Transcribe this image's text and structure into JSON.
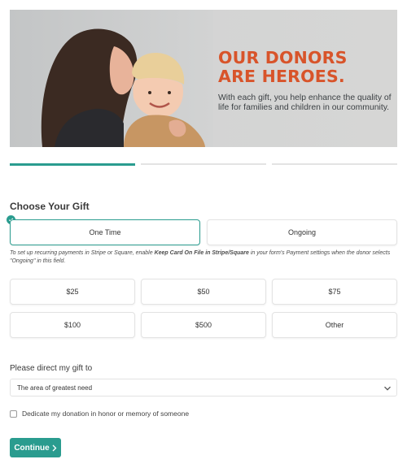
{
  "hero": {
    "title_line1": "OUR DONORS",
    "title_line2": "ARE HEROES.",
    "body": "With each gift, you help enhance the quality of life for families and children in our community."
  },
  "steps": {
    "count": 3,
    "active": 1
  },
  "gift": {
    "title": "Choose Your Gift",
    "frequency": [
      {
        "label": "One Time",
        "selected": true
      },
      {
        "label": "Ongoing",
        "selected": false
      }
    ],
    "note_part1": "To set up recurring payments in Stripe or Square, enable ",
    "note_bold": "Keep Card On File in Stripe/Square",
    "note_part2": " in your form's Payment settings when the donor selects \"Ongoing\" in this field.",
    "amounts": [
      "$25",
      "$50",
      "$75",
      "$100",
      "$500",
      "Other"
    ]
  },
  "direct": {
    "label": "Please direct my gift to",
    "selected": "The area of greatest need"
  },
  "dedicate": {
    "label": "Dedicate my donation in honor or memory of someone",
    "checked": false
  },
  "continue_label": "Continue",
  "colors": {
    "accent": "#2a9c8f",
    "hero_title": "#d8542a"
  }
}
